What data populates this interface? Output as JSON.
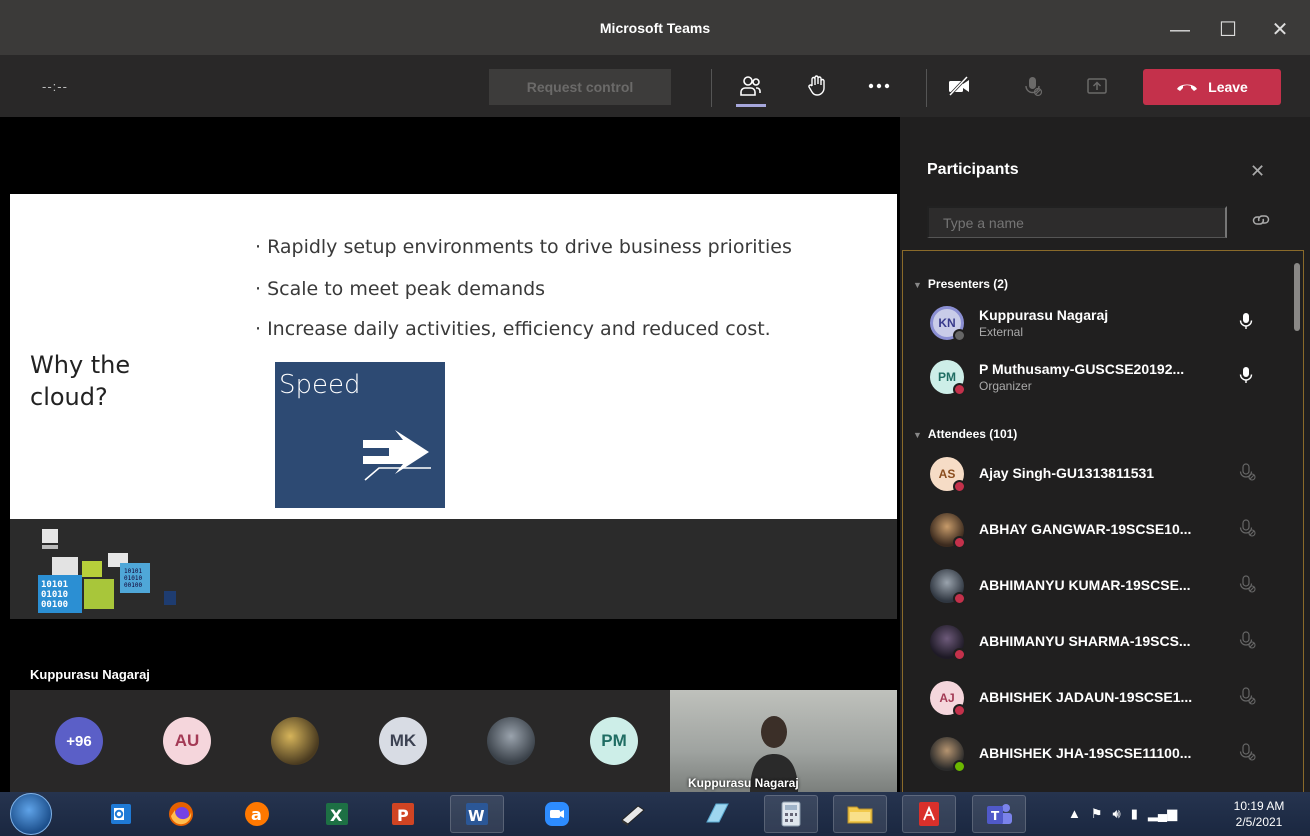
{
  "window": {
    "title": "Microsoft Teams"
  },
  "toolbar": {
    "timer": "--:--",
    "request_control_label": "Request control",
    "leave_label": "Leave"
  },
  "slide": {
    "bullets": [
      "· Rapidly setup environments to drive business priorities",
      "· Scale to meet peak demands",
      "· Increase daily activities, efficiency and reduced cost."
    ],
    "title": "Why the cloud?",
    "tile_label": "Speed"
  },
  "stage": {
    "presenter_name": "Kuppurasu Nagaraj"
  },
  "avatars": {
    "more": "+96",
    "au": "AU",
    "mk": "MK",
    "pm": "PM",
    "self_name": "Kuppurasu Nagaraj"
  },
  "participants": {
    "title": "Participants",
    "search_placeholder": "Type a name",
    "presenters_header": "Presenters (2)",
    "attendees_header": "Attendees (101)",
    "presenters": [
      {
        "initials": "KN",
        "name": "Kuppurasu Nagaraj",
        "role": "External"
      },
      {
        "initials": "PM",
        "name": "P Muthusamy-GUSCSE20192...",
        "role": "Organizer"
      }
    ],
    "attendees": [
      {
        "initials": "AS",
        "name": "Ajay Singh-GU1313811531"
      },
      {
        "initials": "",
        "name": "ABHAY GANGWAR-19SCSE10..."
      },
      {
        "initials": "",
        "name": "ABHIMANYU KUMAR-19SCSE..."
      },
      {
        "initials": "",
        "name": "ABHIMANYU SHARMA-19SCS..."
      },
      {
        "initials": "AJ",
        "name": "ABHISHEK JADAUN-19SCSE1..."
      },
      {
        "initials": "",
        "name": "ABHISHEK JHA-19SCSE11100..."
      }
    ]
  },
  "taskbar": {
    "time": "10:19 AM",
    "date": "2/5/2021"
  },
  "colors": {
    "leave": "#c4314b",
    "teams_purple": "#5b5fc7",
    "slide_tile": "#2d4a73"
  }
}
